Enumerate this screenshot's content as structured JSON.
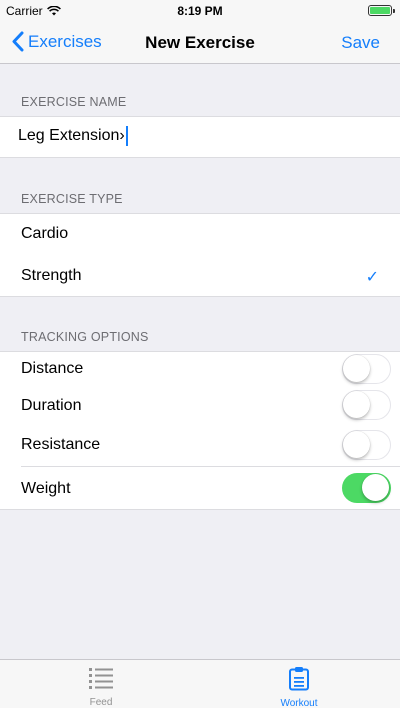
{
  "status_bar": {
    "carrier": "Carrier",
    "time": "8:19 PM"
  },
  "nav": {
    "back_label": "Exercises",
    "title": "New Exercise",
    "save_label": "Save"
  },
  "exercise_name": {
    "header": "EXERCISE NAME",
    "value": "Leg Extension›"
  },
  "exercise_type": {
    "header": "EXERCISE TYPE",
    "options": [
      {
        "label": "Cardio",
        "selected": false
      },
      {
        "label": "Strength",
        "selected": true
      }
    ],
    "check_glyph": "✓"
  },
  "tracking_options": {
    "header": "TRACKING OPTIONS",
    "items": [
      {
        "label": "Distance",
        "on": false
      },
      {
        "label": "Duration",
        "on": false
      },
      {
        "label": "Resistance",
        "on": false
      },
      {
        "label": "Weight",
        "on": true
      }
    ]
  },
  "tab_bar": {
    "tabs": [
      {
        "label": "Feed",
        "icon": "list-icon",
        "active": false
      },
      {
        "label": "Workout",
        "icon": "clipboard-icon",
        "active": true
      }
    ]
  },
  "colors": {
    "accent": "#147efb",
    "toggle_on": "#4cd964",
    "background": "#efeff4"
  }
}
